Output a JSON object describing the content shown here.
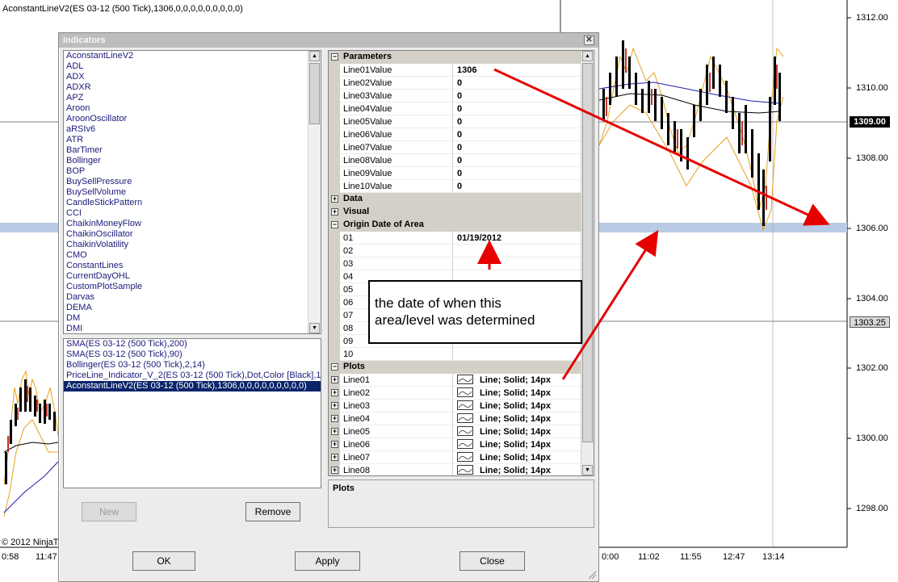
{
  "chart": {
    "title": "AconstantLineV2(ES 03-12 (500 Tick),1306,0,0,0,0,0,0,0,0,0)",
    "copyright": "© 2012 NinjaT",
    "price_labels": [
      "1312.00",
      "1310.00",
      "1308.00",
      "1306.00",
      "1304.00",
      "1302.00",
      "1300.00",
      "1298.00"
    ],
    "current_price": "1309.00",
    "line_price": "1303.25",
    "time_labels": [
      "0:58",
      "11:47",
      "0:00",
      "11:02",
      "11:55",
      "12:47",
      "13:14"
    ],
    "colors": {
      "highlight_band": "#b9cbe4",
      "sma_blue": "#1c1ca8",
      "bollinger_orange": "#e8a020",
      "arrow_red": "#e60000"
    }
  },
  "dialog": {
    "title": "Indicators",
    "close_icon": "close-icon",
    "indicators": [
      "AconstantLineV2",
      "ADL",
      "ADX",
      "ADXR",
      "APZ",
      "Aroon",
      "AroonOscillator",
      "aRSIv6",
      "ATR",
      "BarTimer",
      "Bollinger",
      "BOP",
      "BuySellPressure",
      "BuySellVolume",
      "CandleStickPattern",
      "CCI",
      "ChaikinMoneyFlow",
      "ChaikinOscillator",
      "ChaikinVolatility",
      "CMO",
      "ConstantLines",
      "CurrentDayOHL",
      "CustomPlotSample",
      "Darvas",
      "DEMA",
      "DM",
      "DMI"
    ],
    "applied": [
      "SMA(ES 03-12 (500 Tick),200)",
      "SMA(ES 03-12 (500 Tick),90)",
      "Bollinger(ES 03-12 (500 Tick),2,14)",
      "PriceLine_Indicator_V_2(ES 03-12 (500 Tick),Dot,Color [Black],1)",
      "AconstantLineV2(ES 03-12 (500 Tick),1306,0,0,0,0,0,0,0,0,0)"
    ],
    "buttons": {
      "new": "New",
      "remove": "Remove",
      "ok": "OK",
      "apply": "Apply",
      "close": "Close"
    },
    "grid": {
      "parameters_label": "Parameters",
      "parameters": [
        {
          "name": "Line01Value",
          "value": "1306"
        },
        {
          "name": "Line02Value",
          "value": "0"
        },
        {
          "name": "Line03Value",
          "value": "0"
        },
        {
          "name": "Line04Value",
          "value": "0"
        },
        {
          "name": "Line05Value",
          "value": "0"
        },
        {
          "name": "Line06Value",
          "value": "0"
        },
        {
          "name": "Line07Value",
          "value": "0"
        },
        {
          "name": "Line08Value",
          "value": "0"
        },
        {
          "name": "Line09Value",
          "value": "0"
        },
        {
          "name": "Line10Value",
          "value": "0"
        }
      ],
      "data_label": "Data",
      "visual_label": "Visual",
      "origin_label": "Origin Date of Area",
      "origin": [
        {
          "name": "01",
          "value": "01/19/2012"
        },
        {
          "name": "02",
          "value": ""
        },
        {
          "name": "03",
          "value": ""
        },
        {
          "name": "04",
          "value": ""
        },
        {
          "name": "05",
          "value": ""
        },
        {
          "name": "06",
          "value": ""
        },
        {
          "name": "07",
          "value": ""
        },
        {
          "name": "08",
          "value": ""
        },
        {
          "name": "09",
          "value": ""
        },
        {
          "name": "10",
          "value": ""
        }
      ],
      "plots_label": "Plots",
      "plots": [
        {
          "name": "Line01",
          "value": "Line; Solid; 14px"
        },
        {
          "name": "Line02",
          "value": "Line; Solid; 14px"
        },
        {
          "name": "Line03",
          "value": "Line; Solid; 14px"
        },
        {
          "name": "Line04",
          "value": "Line; Solid; 14px"
        },
        {
          "name": "Line05",
          "value": "Line; Solid; 14px"
        },
        {
          "name": "Line06",
          "value": "Line; Solid; 14px"
        },
        {
          "name": "Line07",
          "value": "Line; Solid; 14px"
        },
        {
          "name": "Line08",
          "value": "Line; Solid; 14px"
        }
      ]
    },
    "description_title": "Plots"
  },
  "annotation": {
    "text_line1": "the date of when this",
    "text_line2": "area/level was determined"
  }
}
